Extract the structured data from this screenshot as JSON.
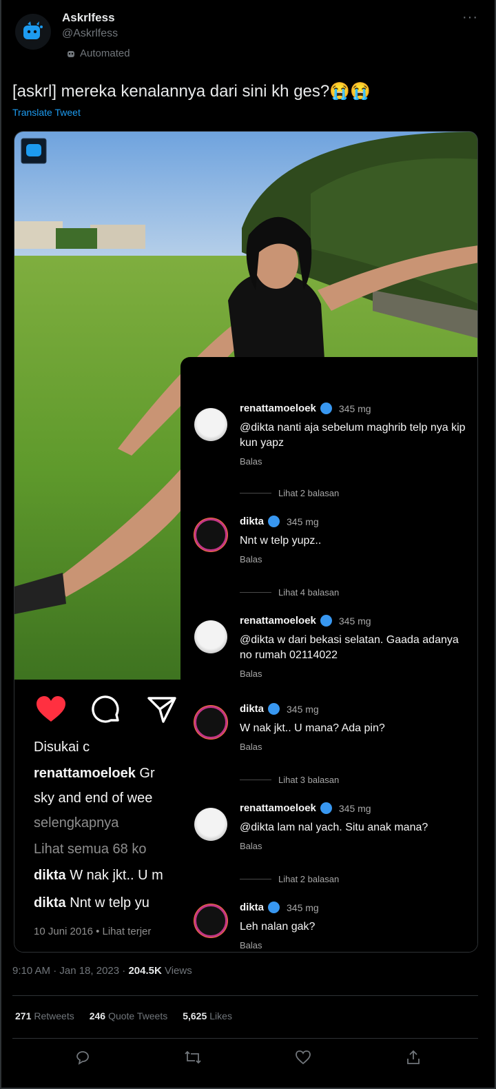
{
  "author": {
    "name": "Askrlfess",
    "handle": "@Askrlfess",
    "label": "Automated"
  },
  "more": "···",
  "tweet": {
    "text": "[askrl] mereka kenalannya dari sini kh ges?😭😭",
    "translate": "Translate Tweet"
  },
  "ig": {
    "liked": "Disukai c",
    "caption_user": "renattamoeloek",
    "caption_text": " Gr",
    "caption_line2": "sky and end of wee",
    "more": "selengkapnya",
    "view_all": "Lihat semua 68 ko",
    "c1_user": "dikta",
    "c1_text": " W nak jkt.. U m",
    "c2_user": "dikta",
    "c2_text": " Nnt w telp yu",
    "date": "10 Juni 2016 • Lihat terjer"
  },
  "comments": [
    {
      "user": "renattamoeloek",
      "time": "345 mg",
      "text": "@dikta nanti aja sebelum maghrib telp nya kip kun yapz",
      "reply": "Balas"
    },
    {
      "user": "dikta",
      "time": "345 mg",
      "text": "Nnt w telp yupz..",
      "reply": "Balas"
    },
    {
      "user": "renattamoeloek",
      "time": "345 mg",
      "text": "@dikta w dari bekasi selatan. Gaada adanya no rumah 02114022",
      "reply": "Balas"
    },
    {
      "user": "dikta",
      "time": "345 mg",
      "text": "W nak jkt.. U mana? Ada pin?",
      "reply": "Balas"
    },
    {
      "user": "renattamoeloek",
      "time": "345 mg",
      "text": "@dikta lam nal yach. Situ anak mana?",
      "reply": "Balas"
    },
    {
      "user": "dikta",
      "time": "345 mg",
      "text": "Leh nalan gak?",
      "reply": "Balas"
    }
  ],
  "view_replies": [
    "Lihat 2 balasan",
    "Lihat 4 balasan",
    "Lihat 3 balasan",
    "Lihat 2 balasan"
  ],
  "meta": {
    "time": "9:10 AM · Jan 18, 2023 · ",
    "views_count": "204.5K",
    "views_label": " Views"
  },
  "stats": {
    "retweets_count": "271",
    "retweets_label": "Retweets",
    "quotes_count": "246",
    "quotes_label": "Quote Tweets",
    "likes_count": "5,625",
    "likes_label": "Likes"
  },
  "colors": {
    "accent": "#1d9bf0",
    "like": "#ff3040",
    "verified": "#3897f0"
  }
}
